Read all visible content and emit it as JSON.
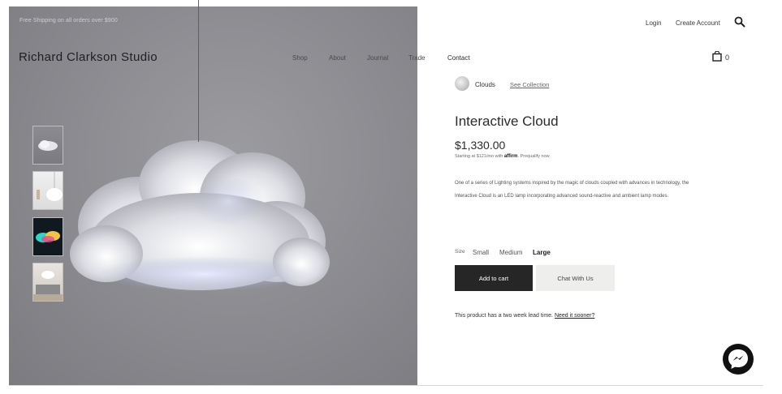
{
  "promo": "Free Shipping on all orders over $900",
  "brand": "Richard Clarkson Studio",
  "header": {
    "login": "Login",
    "create_account": "Create Account"
  },
  "nav": [
    "Shop",
    "About",
    "Journal",
    "Trade",
    "Contact"
  ],
  "cart": {
    "count": "0"
  },
  "collection": {
    "name": "Clouds",
    "link": "See Collection"
  },
  "product": {
    "title": "Interactive Cloud",
    "price": "$1,330.00",
    "financing_prefix": "Starting at $121/mo with",
    "financing_brand": "affirm",
    "financing_suffix": ". Prequalify now",
    "description": "One of a series of Lighting systems inspired by the magic of clouds coupled with advances in technology, the Interactive Cloud is an  LED lamp incorporating advanced sound-reactive and ambient lamp modes."
  },
  "size": {
    "label": "Size",
    "options": [
      "Small",
      "Medium",
      "Large"
    ],
    "selected": "Large"
  },
  "buttons": {
    "add_to_cart": "Add to cart",
    "chat": "Chat With Us"
  },
  "lead_time": {
    "text": "This product has a two week lead time.",
    "link": "Need it sooner?"
  },
  "icons": {
    "search": "search-icon",
    "cart": "shopping-bag-icon",
    "messenger": "messenger-icon"
  },
  "colors": {
    "button_dark": "#262626",
    "button_light": "#eeeeec"
  }
}
